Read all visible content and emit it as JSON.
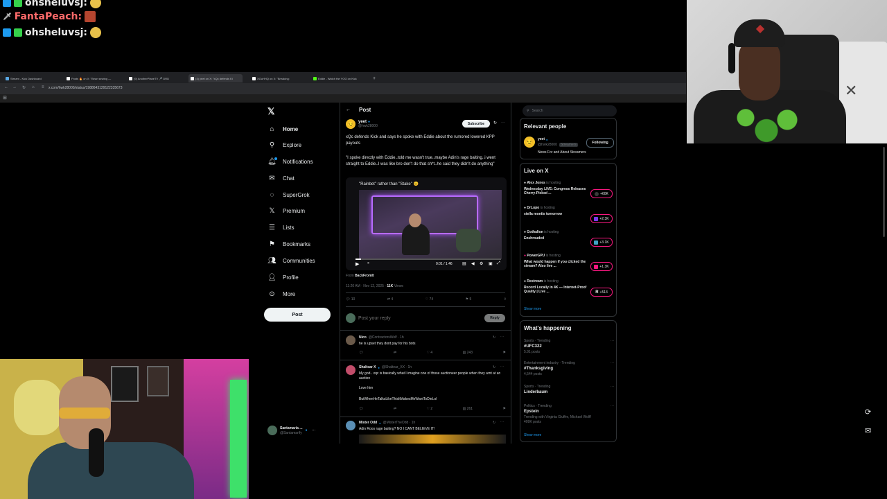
{
  "chat": [
    {
      "user": "ohsheluvsj:",
      "color": "#e8e8e8"
    },
    {
      "user": "FantaPeach:",
      "color": "#ff6b6b"
    },
    {
      "user": "ohsheluvsj:",
      "color": "#e8e8e8"
    }
  ],
  "browser": {
    "tabs": [
      "Stream - Kick Dashboard",
      "Posts 🔥 on X: \"Bean sewing —",
      "(9) AnotherPlaneTV 🎤 DRD",
      "(4) yeet on X: \"xQc defends Ki",
      "XGuHHQ on X: \"Breaking:",
      "Eddie - Watch the YOO on Kick"
    ],
    "url": "x.com/hwk28000/status/1988643129122335673"
  },
  "nav": {
    "items": [
      {
        "label": "Home",
        "icon": "home-icon"
      },
      {
        "label": "Explore",
        "icon": "search-icon"
      },
      {
        "label": "Notifications",
        "icon": "bell-icon"
      },
      {
        "label": "Chat",
        "icon": "mail-icon"
      },
      {
        "label": "SuperGrok",
        "icon": "grok-icon"
      },
      {
        "label": "Premium",
        "icon": "x-logo-icon"
      },
      {
        "label": "Lists",
        "icon": "list-icon"
      },
      {
        "label": "Bookmarks",
        "icon": "bookmark-icon"
      },
      {
        "label": "Communities",
        "icon": "people-icon"
      },
      {
        "label": "Profile",
        "icon": "person-icon"
      },
      {
        "label": "More",
        "icon": "more-circle-icon"
      }
    ],
    "post_label": "Post",
    "account": {
      "name": "Santamaria ...",
      "handle": "@Santamarify"
    }
  },
  "main": {
    "header_title": "Post",
    "post": {
      "author": "yeet",
      "handle": "@hwk28000",
      "subscribe_label": "Subscribe",
      "text": "xQc defends Kick and says he spoke with Eddie about the rumored lowered KPP payouts",
      "quote": "\"I spoke directly with Eddie..told me wasn't true..maybe Adin's rage baiting..i went straight to Eddie..I was like bro don't do that sh*t..he said they didn't do anything\"",
      "video_caption": "\"Rainbet\" rather than \"Stake\" 😊",
      "video_time": "0:01 / 1:46",
      "from_label": "From",
      "from_name": "BackFromIt",
      "meta_time": "11:20 AM · Nov 12, 2025 ·",
      "views": "11K",
      "views_label": "Views",
      "stats": {
        "replies": "10",
        "reposts": "4",
        "likes": "74",
        "bookmarks": "5"
      },
      "reply_placeholder": "Post your reply",
      "reply_button": "Reply"
    },
    "replies": [
      {
        "name": "Nico",
        "handle": "@ContractorsWolf · 1h",
        "text": "he is upset they dont pay for his bots",
        "likes": "4",
        "views": "243"
      },
      {
        "name": "Shaltear X",
        "handle": "@Shaltear_XX · 1h",
        "text": "My god.. xqc is basically what I imagine one of those auctioneer people when they arnt at an auction",
        "text2": "Love him",
        "text3": "ButWhenHeTalksLikeThisItMakesMeWantToDieLol",
        "likes": "2",
        "views": "261"
      },
      {
        "name": "Mister Odd",
        "handle": "@MisterTheOdd · 1h",
        "text": "Adin Roos rage baiting? NO I CANT BELIEVE IT!"
      }
    ]
  },
  "right": {
    "search_placeholder": "Search",
    "relevant": {
      "title": "Relevant people",
      "name": "yeet",
      "handle": "@hwk28000",
      "tag": "Streamers",
      "bio": "News For and About Streamers",
      "follow_label": "Following"
    },
    "live": {
      "title": "Live on X",
      "hosting_label": "is hosting",
      "items": [
        {
          "host": "Alex Jones",
          "title": "Wednesday LIVE: Congress Releases Cherry-Picked ...",
          "count": "+60K"
        },
        {
          "host": "DrLupo",
          "title": "stella montis tomorrow",
          "count": "+2.3K"
        },
        {
          "host": "Gothalion",
          "title": "Enshrouded",
          "count": "+3.1K"
        },
        {
          "host": "PowerGPU",
          "title": "What would happen if you clicked the stream? Also live ...",
          "count": "+1.3K"
        },
        {
          "host": "Restream",
          "title": "Record Locally in 4K — Internet-Proof Quality | Live ...",
          "count": "+513"
        }
      ],
      "show_more": "Show more"
    },
    "happening": {
      "title": "What's happening",
      "items": [
        {
          "context": "Sports · Trending",
          "topic": "#UFC322",
          "count": "5.91 posts"
        },
        {
          "context": "Entertainment industry · Trending",
          "topic": "#Thanksgiving",
          "count": "4,544 posts"
        },
        {
          "context": "Sports · Trending",
          "topic": "Linderbaum",
          "count": ""
        },
        {
          "context": "Politics · Trending",
          "topic": "Epstein",
          "count": "Trending with Virginia Giuffre, Michael Wolff",
          "extra": "409K posts"
        }
      ],
      "show_more": "Show more"
    }
  },
  "colors": {
    "accent": "#1d9bf0",
    "live": "#f91880",
    "bg": "#000000"
  }
}
